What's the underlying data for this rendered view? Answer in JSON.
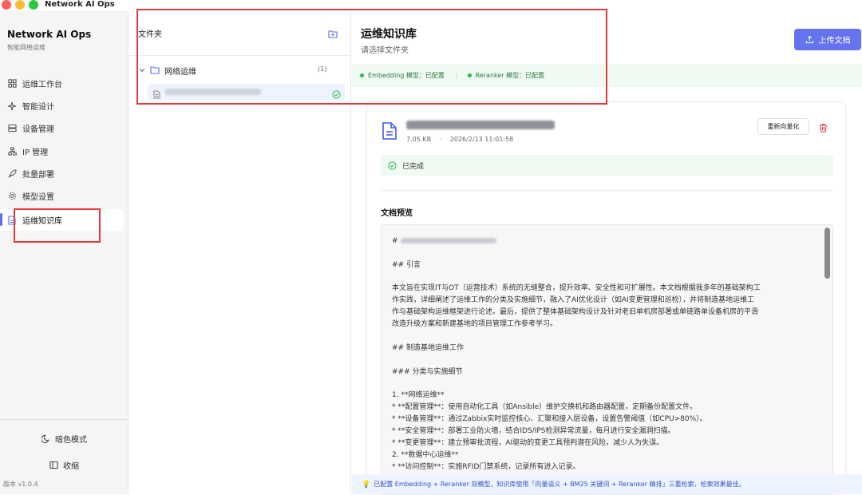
{
  "window": {
    "title": "Network AI Ops"
  },
  "sidebar": {
    "brand": "Network AI Ops",
    "subtitle": "智能网络运维",
    "items": [
      {
        "label": "运维工作台",
        "icon": "dashboard-icon"
      },
      {
        "label": "智能设计",
        "icon": "sparkle-icon"
      },
      {
        "label": "设备管理",
        "icon": "server-icon"
      },
      {
        "label": "IP 管理",
        "icon": "network-icon"
      },
      {
        "label": "批量部署",
        "icon": "rocket-icon"
      },
      {
        "label": "模型设置",
        "icon": "gear-icon"
      },
      {
        "label": "运维知识库",
        "icon": "document-icon",
        "active": true
      }
    ],
    "dark_mode": "暗色模式",
    "collapse": "收缩",
    "version": "版本 v1.0.4"
  },
  "folders": {
    "title": "文件夹",
    "tree": [
      {
        "name": "网络运维",
        "count": "(1)"
      }
    ]
  },
  "main": {
    "title": "运维知识库",
    "subtitle": "请选择文件夹",
    "upload_label": "上传文档",
    "status": {
      "embedding": "Embedding 模型：已配置",
      "separator": "|",
      "reranker": "Reranker 模型：已配置"
    }
  },
  "document": {
    "size": "7.05 KB",
    "dot": "·",
    "date": "2026/2/13 11:01:58",
    "revectorize_label": "重新向量化",
    "state": "已完成",
    "preview_title": "文档预览",
    "preview_lines": [
      "#",
      "",
      "## 引言",
      "",
      "本文旨在实现IT与OT（运营技术）系统的无缝整合，提升效率、安全性和可扩展性。本文档根据我多年的基础架构工",
      "作实践，详细阐述了运维工作的分类及实施细节，融入了AI优化设计（如AI变更管理和巡检），并将制造基地运维工",
      "作与基础架构运维框架进行论述。最后，提供了整体基础架构设计及针对老旧单机房部署或单链路单设备机房的平滑",
      "改造升级方案和新建基地的项目管理工作参考学习。",
      "",
      "## 制造基地运维工作",
      "",
      "### 分类与实施细节",
      "",
      "1. **网络运维**",
      "   * **配置管理**：使用自动化工具（如Ansible）维护交换机和路由器配置，定期备份配置文件。",
      "   * **设备管理**：通过Zabbix实时监控核心、汇聚和接入层设备，设置告警阈值（如CPU>80%）。",
      "   * **安全管理**：部署工业防火墙，结合IDS/IPS检测异常流量，每月进行安全漏洞扫描。",
      "   * **变更管理**：建立预审批流程，AI驱动的变更工具预判潜在风险，减少人为失误。",
      "2. **数据中心运维**",
      "   * **访问控制**：实施RFID门禁系统，记录所有进入记录。"
    ]
  },
  "tip": {
    "icon": "lightbulb-icon",
    "text": "已配置 Embedding + Reranker 双模型，知识库使用「向量语义 + BM25 关键词 + Reranker 精排」三重检索，检索效果最佳。"
  },
  "colors": {
    "accent": "#6474f0",
    "success": "#2fb350",
    "danger": "#e04040",
    "highlight": "#e23a3a"
  }
}
